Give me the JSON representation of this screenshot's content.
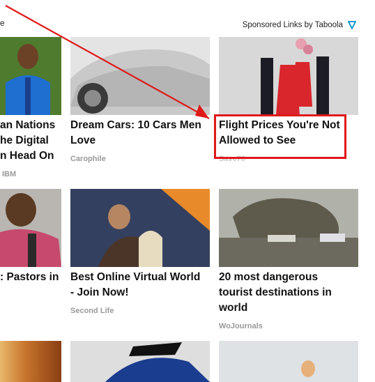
{
  "header": {
    "fragment": "e",
    "sponsored": "Sponsored Links by Taboola"
  },
  "cards": [
    {
      "title_lines": [
        "an Nations",
        "he Digital",
        "n Head On"
      ],
      "source": "IBM"
    },
    {
      "title_lines": [
        "Dream Cars: 10 Cars Men",
        "Love"
      ],
      "source": "Carophile"
    },
    {
      "title_lines": [
        "Flight Prices You're Not",
        "Allowed to See"
      ],
      "source": "Save70"
    },
    {
      "title_lines": [
        ": Pastors in"
      ],
      "source": ""
    },
    {
      "title_lines": [
        "Best Online Virtual World",
        "- Join Now!"
      ],
      "source": "Second Life"
    },
    {
      "title_lines": [
        "20 most dangerous",
        "tourist destinations in",
        "world"
      ],
      "source": "WoJournals"
    }
  ],
  "colors": {
    "highlight": "#e01818",
    "link_text": "#111111",
    "source_text": "#999999",
    "taboola": "#1a9ad6"
  },
  "icons": {
    "taboola": "taboola-logo-icon",
    "arrow": "red-annotation-arrow"
  }
}
